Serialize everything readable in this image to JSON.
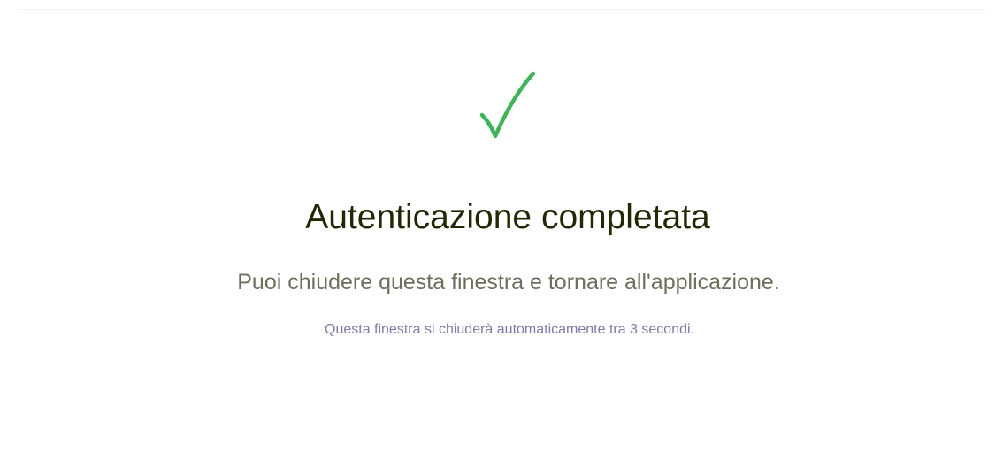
{
  "page": {
    "background": "#ffffff"
  },
  "status": {
    "icon": "checkmark-icon",
    "icon_color": "#3fb356",
    "title": "Autenticazione completata",
    "title_color": "#1f2a05",
    "subtitle": "Puoi chiudere questa finestra e tornare all'applicazione.",
    "subtitle_color": "#6b6f5c",
    "note": "Questa finestra si chiuderà automaticamente tra 3 secondi.",
    "note_color": "#7d7aa8"
  }
}
